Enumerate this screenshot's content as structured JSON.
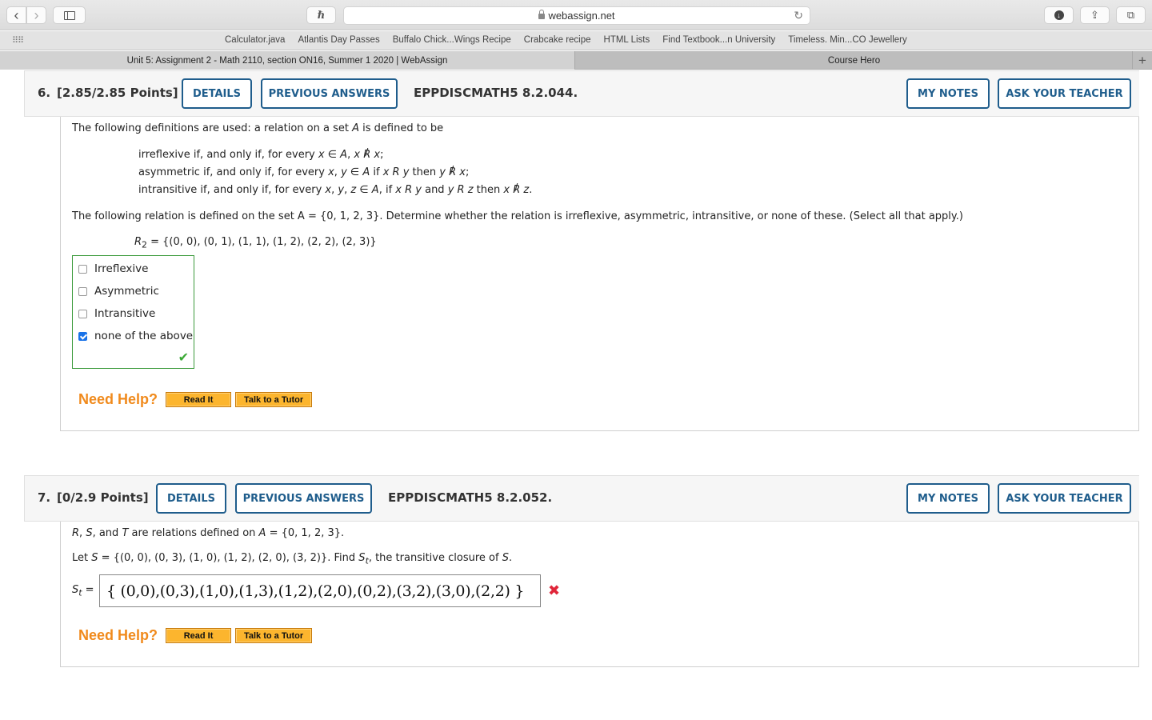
{
  "browser": {
    "url": "webassign.net",
    "bookmarks": [
      "Calculator.java",
      "Atlantis Day Passes",
      "Buffalo Chick...Wings Recipe",
      "Crabcake recipe",
      "HTML Lists",
      "Find Textbook...n University",
      "Timeless. Min...CO Jewellery"
    ],
    "tabs": [
      {
        "label": "Unit 5: Assignment 2 - Math 2110, section ON16, Summer 1 2020 | WebAssign",
        "active": true
      },
      {
        "label": "Course Hero",
        "active": false
      }
    ],
    "icons": {
      "back": "‹",
      "forward": "›",
      "reload": "↻",
      "new_tab": "+"
    }
  },
  "questions": [
    {
      "number": "6.",
      "points": "[2.85/2.85 Points]",
      "details_label": "DETAILS",
      "previous_answers_label": "PREVIOUS ANSWERS",
      "code": "EPPDISCMATH5 8.2.044.",
      "my_notes_label": "MY NOTES",
      "ask_teacher_label": "ASK YOUR TEACHER",
      "intro": "The following definitions are used: a relation on a set A is defined to be",
      "definitions": [
        "irreflexive if, and only if, for every x ∈ A, x R̸ x;",
        "asymmetric if, and only if, for every x, y ∈ A if x R y then y R̸ x;",
        "intransitive if, and only if, for every x, y, z ∈ A, if x R y and y R z then x R̸ z."
      ],
      "prompt": "The following relation is defined on the set A = {0, 1, 2, 3}. Determine whether the relation is irreflexive, asymmetric, intransitive, or none of these. (Select all that apply.)",
      "relation": "= {(0, 0), (0, 1), (1, 1), (1, 2), (2, 2), (2, 3)}",
      "relation_name": "R",
      "relation_sub": "2",
      "choices": [
        {
          "label": "Irreflexive",
          "checked": false
        },
        {
          "label": "Asymmetric",
          "checked": false
        },
        {
          "label": "Intransitive",
          "checked": false
        },
        {
          "label": "none of the above",
          "checked": true
        }
      ],
      "status": "correct",
      "need_help": "Need Help?",
      "read_it": "Read It",
      "talk_tutor": "Talk to a Tutor"
    },
    {
      "number": "7.",
      "points": "[0/2.9 Points]",
      "details_label": "DETAILS",
      "previous_answers_label": "PREVIOUS ANSWERS",
      "code": "EPPDISCMATH5 8.2.052.",
      "my_notes_label": "MY NOTES",
      "ask_teacher_label": "ASK YOUR TEACHER",
      "line1_suffix": "are relations defined on",
      "line1_set": "= {0, 1, 2, 3}.",
      "line2_prefix": "Let",
      "line2_set": "= {(0, 0), (0, 3), (1, 0), (1, 2), (2, 0), (3, 2)}. Find",
      "line2_suffix": ", the transitive closure of",
      "answer_label": "=",
      "answer_value": "{ (0,0),(0,3),(1,0),(1,3),(1,2),(2,0),(0,2),(3,2),(3,0),(2,2) }",
      "status": "incorrect",
      "need_help": "Need Help?",
      "read_it": "Read It",
      "talk_tutor": "Talk to a Tutor"
    }
  ]
}
